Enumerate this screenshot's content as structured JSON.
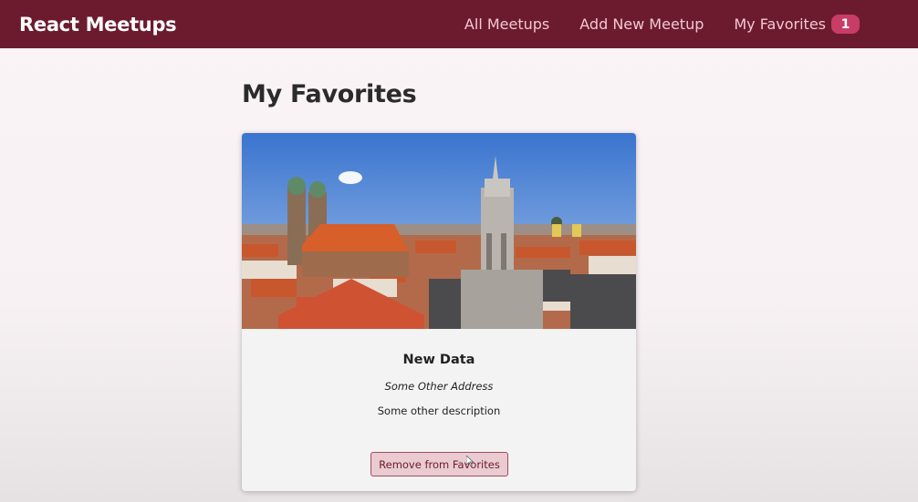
{
  "header": {
    "logo": "React Meetups",
    "nav": {
      "all_meetups": "All Meetups",
      "add_new_meetup": "Add New Meetup",
      "my_favorites": "My Favorites",
      "favorites_count": "1"
    }
  },
  "main": {
    "title": "My Favorites",
    "meetups": [
      {
        "image_icon": "city-skyline-photo",
        "title": "New Data",
        "address": "Some Other Address",
        "description": "Some other description",
        "button_label": "Remove from Favorites"
      }
    ]
  },
  "colors": {
    "header_bg": "#6c1b2e",
    "nav_link": "#f2c7d4",
    "badge_bg": "#c83d67",
    "button_bg": "#e9cbd1",
    "button_border": "#a34b63"
  }
}
